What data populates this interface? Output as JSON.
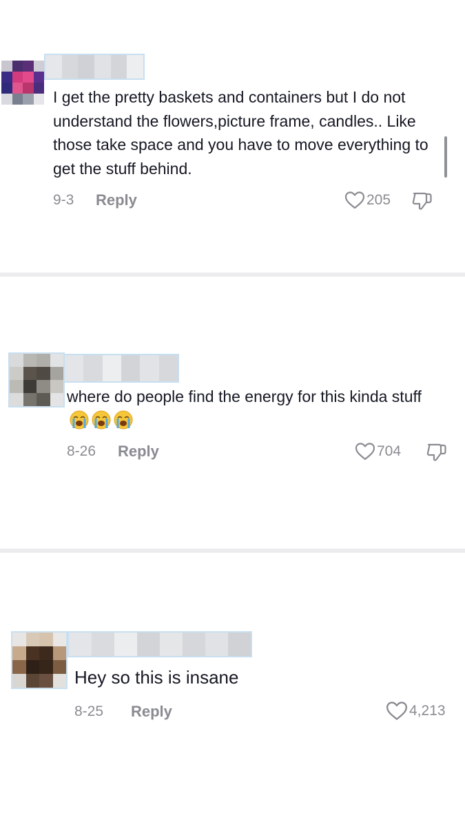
{
  "comments": [
    {
      "text": "I get the pretty baskets and containers but I do not understand the flowers,picture frame, candles.. Like those take space and you have to move everything to get the stuff behind.",
      "date": "9-3",
      "reply_label": "Reply",
      "likes": "205",
      "has_dislike": true
    },
    {
      "text": "where do people find the energy for this kinda stuff",
      "emoji": [
        "loudly-crying-face",
        "loudly-crying-face",
        "loudly-crying-face"
      ],
      "date": "8-26",
      "reply_label": "Reply",
      "likes": "704",
      "has_dislike": true
    },
    {
      "text": "Hey so this is insane",
      "date": "8-25",
      "reply_label": "Reply",
      "likes": "4,213",
      "has_dislike": false
    }
  ],
  "icons": {
    "like": "heart-outline-icon",
    "dislike": "thumbs-down-icon",
    "emoji": "loudly-crying-face-emoji"
  },
  "colors": {
    "text": "#161823",
    "meta": "#8a8b91",
    "divider": "#ececee"
  }
}
